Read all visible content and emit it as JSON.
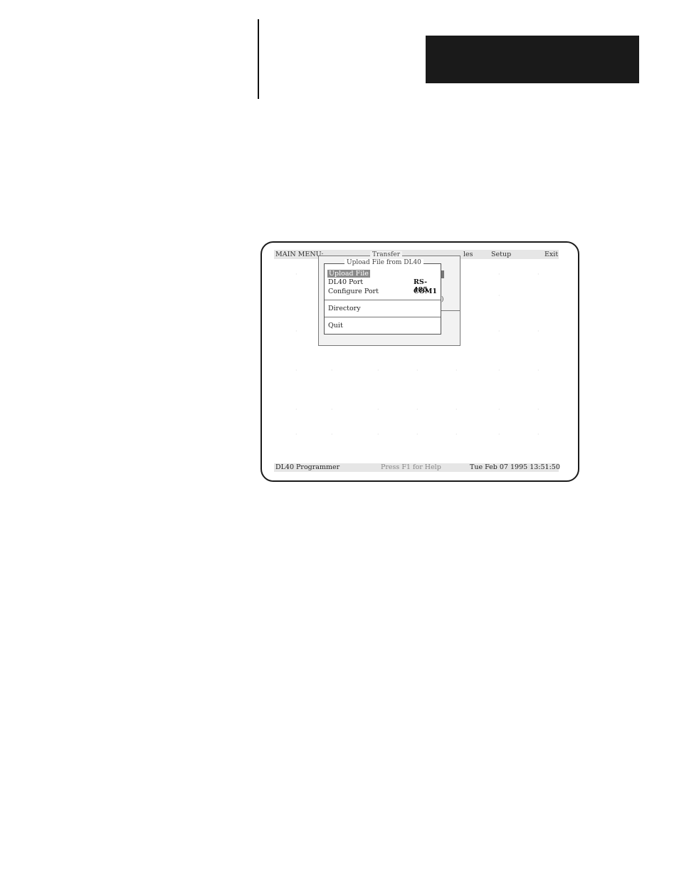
{
  "menubar": {
    "main_menu": "MAIN MENU:",
    "files_partial": "les",
    "setup": "Setup",
    "exit": "Exit"
  },
  "transfer_dialog": {
    "title": "Transfer",
    "partial_char": ")"
  },
  "upload_dialog": {
    "title": "Upload File from DL40",
    "items": [
      {
        "label": "Upload File",
        "value": ""
      },
      {
        "label": "DL40 Port",
        "value": "RS-485"
      },
      {
        "label": "Configure Port",
        "value": "COM1"
      },
      {
        "label": "Directory",
        "value": ""
      },
      {
        "label": "Quit",
        "value": ""
      }
    ]
  },
  "statusbar": {
    "app_name": "DL40 Programmer",
    "help_hint": "Press F1 for Help",
    "datetime": "Tue Feb 07 1995 13:51:50"
  }
}
